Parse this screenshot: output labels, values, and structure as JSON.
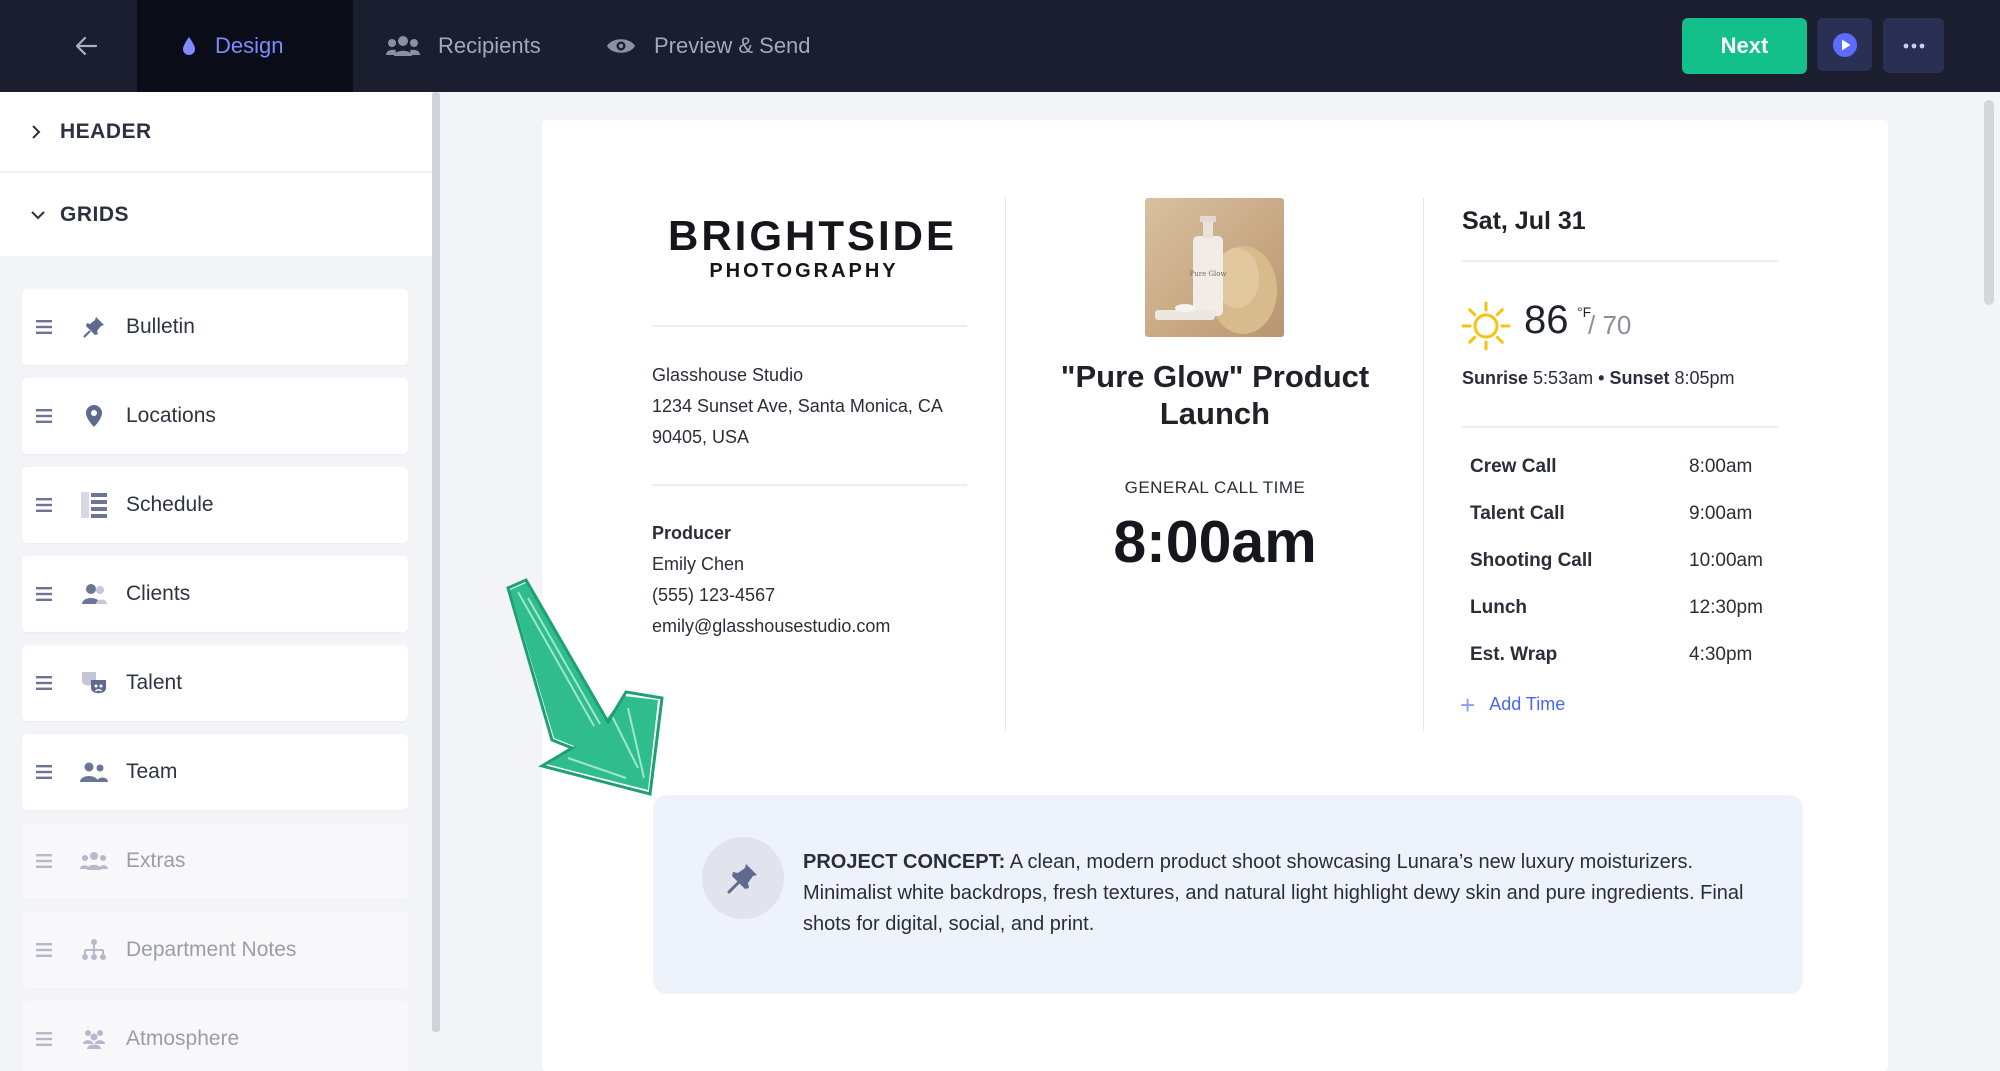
{
  "topbar": {
    "tabs": [
      {
        "label": "Design",
        "active": true
      },
      {
        "label": "Recipients",
        "active": false
      },
      {
        "label": "Preview & Send",
        "active": false
      }
    ],
    "next_label": "Next",
    "colors": {
      "bar": "#1b1e2e",
      "active_tab": "#0a0c18",
      "accent": "#7d8cff",
      "next": "#13c08a"
    }
  },
  "sidebar": {
    "header_label": "HEADER",
    "grids_label": "GRIDS",
    "items": [
      {
        "label": "Bulletin",
        "icon": "pin-icon",
        "enabled": true
      },
      {
        "label": "Locations",
        "icon": "location-pin-icon",
        "enabled": true
      },
      {
        "label": "Schedule",
        "icon": "schedule-list-icon",
        "enabled": true
      },
      {
        "label": "Clients",
        "icon": "clients-icon",
        "enabled": true
      },
      {
        "label": "Talent",
        "icon": "theater-masks-icon",
        "enabled": true
      },
      {
        "label": "Team",
        "icon": "team-icon",
        "enabled": true
      },
      {
        "label": "Extras",
        "icon": "extras-group-icon",
        "enabled": false
      },
      {
        "label": "Department Notes",
        "icon": "org-chart-icon",
        "enabled": false
      },
      {
        "label": "Atmosphere",
        "icon": "crowd-icon",
        "enabled": false
      }
    ]
  },
  "callsheet": {
    "logo": {
      "line1": "BRIGHTSIDE",
      "line2": "PHOTOGRAPHY"
    },
    "location": {
      "name": "Glasshouse Studio",
      "address1": "1234 Sunset Ave, Santa Monica, CA",
      "address2": "90405, USA"
    },
    "producer": {
      "role": "Producer",
      "name": "Emily Chen",
      "phone": "(555) 123-4567",
      "email": "emily@glasshousestudio.com"
    },
    "product_image_text": "Pure Glow",
    "title": "\"Pure Glow\" Product Launch",
    "general_call_label": "GENERAL CALL TIME",
    "general_call_time": "8:00am",
    "date": "Sat, Jul 31",
    "weather": {
      "high": "86",
      "unit": "°F",
      "low": "/ 70",
      "sunrise_label": "Sunrise",
      "sunrise": "5:53am",
      "separator": "•",
      "sunset_label": "Sunset",
      "sunset": "8:05pm"
    },
    "calls": [
      {
        "label": "Crew Call",
        "time": "8:00am"
      },
      {
        "label": "Talent Call",
        "time": "9:00am"
      },
      {
        "label": "Shooting Call",
        "time": "10:00am"
      },
      {
        "label": "Lunch",
        "time": "12:30pm"
      },
      {
        "label": "Est. Wrap",
        "time": "4:30pm"
      }
    ],
    "add_time_label": "Add Time",
    "concept": {
      "label": "PROJECT CONCEPT:",
      "text": "A clean, modern product shoot showcasing Lunara’s new luxury moisturizers. Minimalist white backdrops, fresh textures, and natural light highlight dewy skin and pure ingredients. Final shots for digital, social, and print."
    }
  }
}
